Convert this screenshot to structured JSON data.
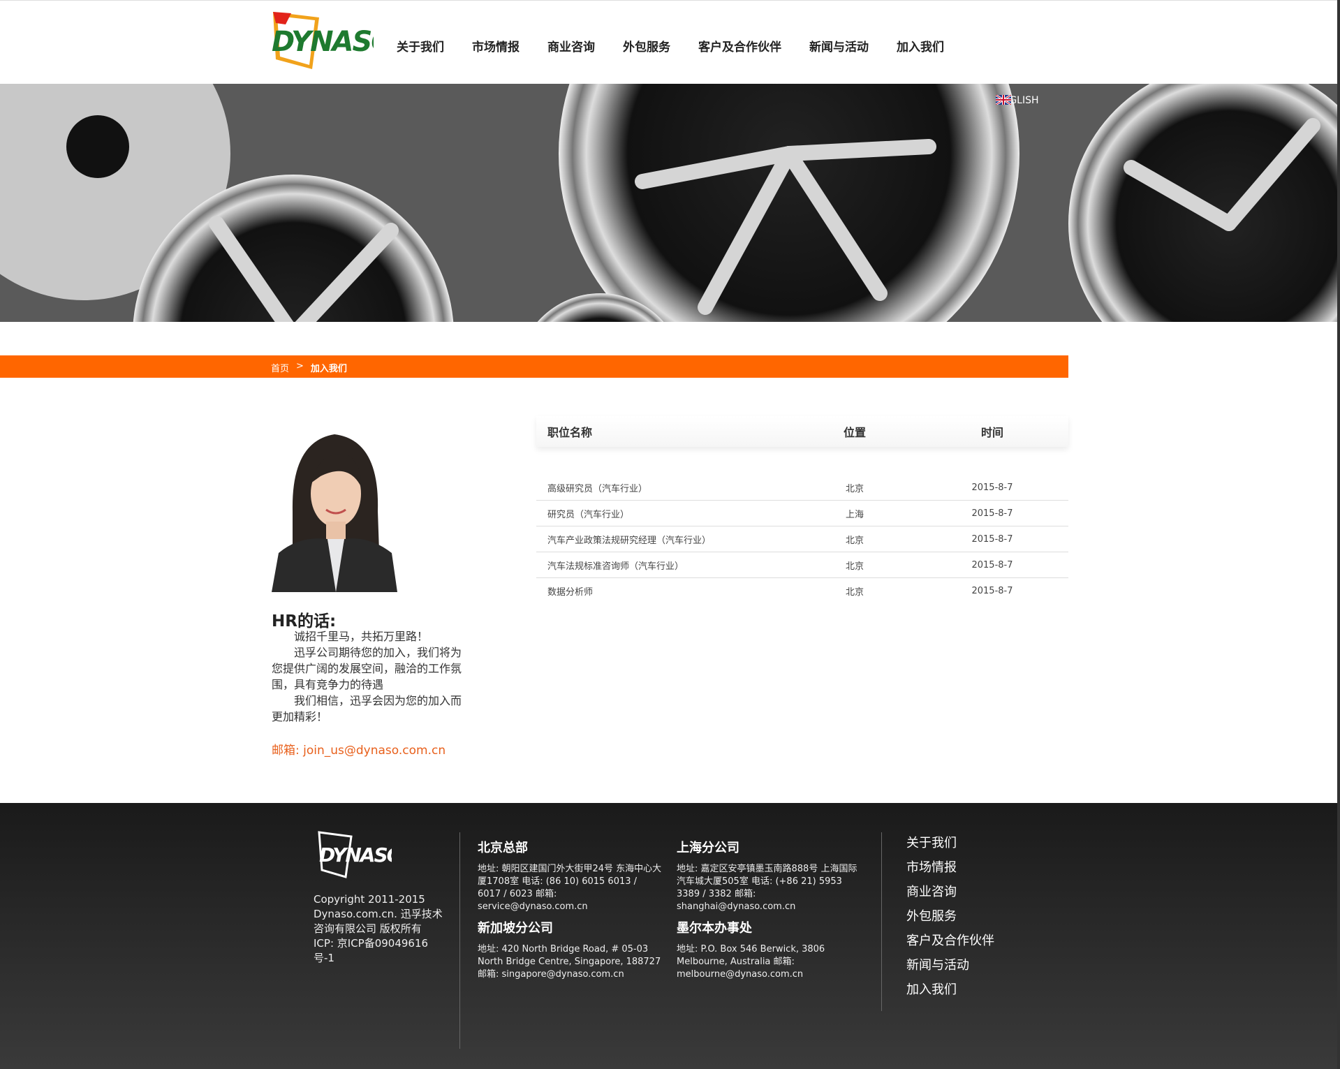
{
  "header": {
    "logo_text": "DYNASO",
    "nav": [
      "关于我们",
      "市场情报",
      "商业咨询",
      "外包服务",
      "客户及合作伙伴",
      "新闻与活动",
      "加入我们"
    ]
  },
  "banner": {
    "language_label": "ENGLISH",
    "language_icon": "uk-flag-icon"
  },
  "breadcrumb": {
    "home": "首页",
    "separator": ">",
    "current": "加入我们"
  },
  "hr": {
    "title": "HR的话:",
    "paragraphs": [
      "诚招千里马，共拓万里路！",
      "迅孚公司期待您的加入，我们将为您提供广阔的发展空间，融洽的工作氛围，具有竞争力的待遇",
      "我们相信，迅孚会因为您的加入而更加精彩！"
    ],
    "email_label": "邮箱: ",
    "email": "join_us@dynaso.com.cn"
  },
  "jobs": {
    "headers": [
      "职位名称",
      "位置",
      "时间"
    ],
    "rows": [
      {
        "title": "高级研究员（汽车行业）",
        "location": "北京",
        "date": "2015-8-7"
      },
      {
        "title": "研究员（汽车行业）",
        "location": "上海",
        "date": "2015-8-7"
      },
      {
        "title": "汽车产业政策法规研究经理（汽车行业）",
        "location": "北京",
        "date": "2015-8-7"
      },
      {
        "title": "汽车法规标准咨询师（汽车行业）",
        "location": "北京",
        "date": "2015-8-7"
      },
      {
        "title": "数据分析师",
        "location": "北京",
        "date": "2015-8-7"
      }
    ]
  },
  "footer": {
    "logo_text": "DYNASO",
    "copyright": "Copyright 2011-2015 Dynaso.com.cn. 迅孚技术咨询有限公司 版权所有 ICP: 京ICP备09049616号-1",
    "offices": [
      {
        "name": "北京总部",
        "details": "地址: 朝阳区建国门外大街甲24号 东海中心大厦1708室 电话: (86 10) 6015 6013 / 6017 / 6023 邮箱: service@dynaso.com.cn"
      },
      {
        "name": "上海分公司",
        "details": "地址: 嘉定区安亭镇墨玉南路888号 上海国际汽车城大厦505室 电话: (+86 21) 5953 3389 / 3382 邮箱: shanghai@dynaso.com.cn"
      },
      {
        "name": "新加坡分公司",
        "details": "地址: 420 North Bridge Road, # 05-03 North Bridge Centre, Singapore, 188727 邮箱: singapore@dynaso.com.cn"
      },
      {
        "name": "墨尔本办事处",
        "details": "地址: P.O. Box 546 Berwick, 3806 Melbourne, Australia 邮箱: melbourne@dynaso.com.cn"
      }
    ],
    "links": [
      "关于我们",
      "市场情报",
      "商业咨询",
      "外包服务",
      "客户及合作伙伴",
      "新闻与活动",
      "加入我们"
    ]
  },
  "colors": {
    "accent": "#ff6600",
    "email": "#e8601c",
    "footer_bg": "#2a2a2a"
  }
}
